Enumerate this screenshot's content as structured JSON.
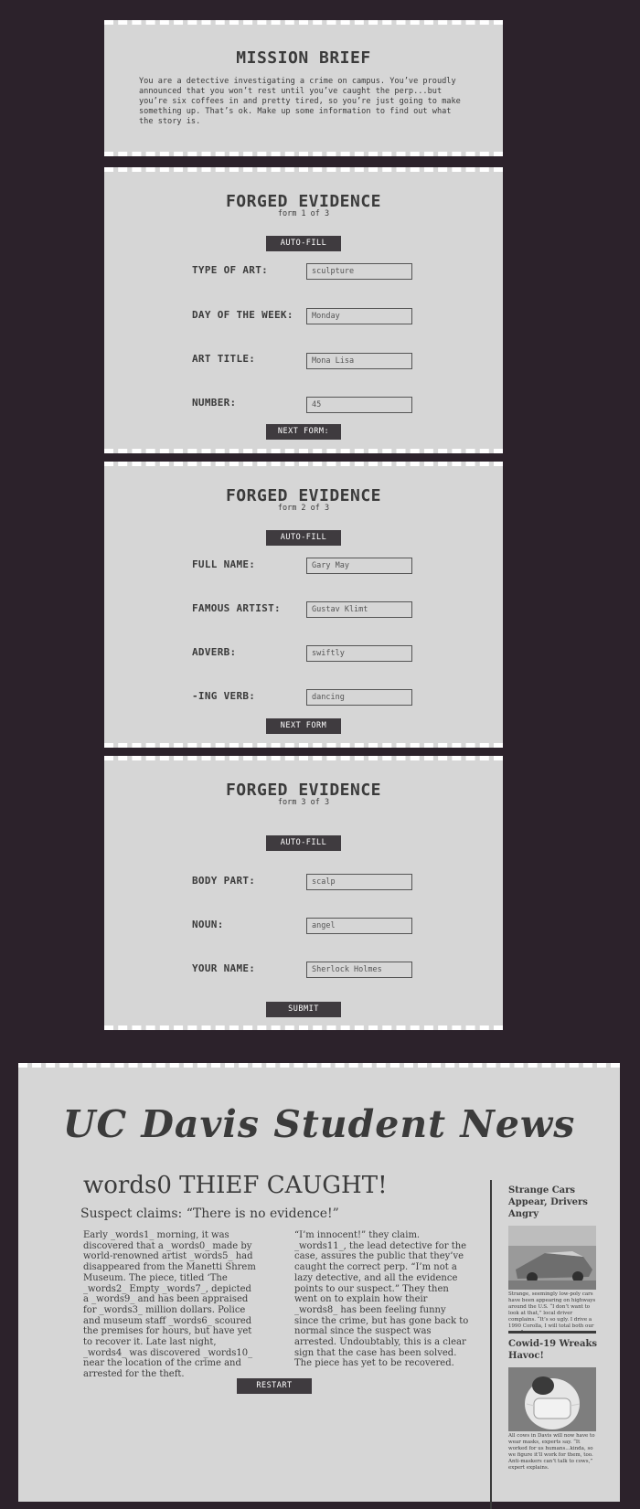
{
  "brief": {
    "title": "MISSION BRIEF",
    "text": "You are a detective investigating a crime on campus. You’ve proudly announced that you won’t rest until you’ve caught the perp...but you’re six coffees in and pretty tired, so you’re just going to make something up. That’s ok. Make up some information to find out what the story is."
  },
  "form1": {
    "title": "FORGED EVIDENCE",
    "subtitle": "form 1 of 3",
    "autofill": "AUTO-FILL",
    "next": "NEXT FORM:",
    "rows": [
      {
        "label": "TYPE OF ART:",
        "value": "sculpture"
      },
      {
        "label": "DAY OF THE WEEK:",
        "value": "Monday"
      },
      {
        "label": "ART TITLE:",
        "value": "Mona Lisa"
      },
      {
        "label": "NUMBER:",
        "value": "45"
      }
    ]
  },
  "form2": {
    "title": "FORGED EVIDENCE",
    "subtitle": "form 2 of 3",
    "autofill": "AUTO-FILL",
    "next": "NEXT FORM",
    "rows": [
      {
        "label": "FULL NAME:",
        "value": "Gary May"
      },
      {
        "label": "FAMOUS ARTIST:",
        "value": "Gustav Klimt"
      },
      {
        "label": "ADVERB:",
        "value": "swiftly"
      },
      {
        "label": "-ING VERB:",
        "value": "dancing"
      }
    ]
  },
  "form3": {
    "title": "FORGED EVIDENCE",
    "subtitle": "form 3 of 3",
    "autofill": "AUTO-FILL",
    "submit": "SUBMIT",
    "rows": [
      {
        "label": "BODY PART:",
        "value": "scalp"
      },
      {
        "label": "NOUN:",
        "value": "angel"
      },
      {
        "label": "YOUR NAME:",
        "value": "Sherlock Holmes"
      }
    ]
  },
  "news": {
    "masthead": "UC Davis Student News",
    "headline": "words0 THIEF CAUGHT!",
    "subhead": "Suspect claims: “There is no evidence!”",
    "col1": "Early _words1_ morning, it was discovered that a _words0_ made by world-renowned artist _words5_ had disappeared from the Manetti Shrem Museum. The piece, titled ‘The _words2_ Empty _words7_, depicted a _words9_ and has been appraised for _words3_ million dollars. Police and museum staff _words6_ scoured the premises for hours, but have yet to recover it. Late last night, _words4_ was discovered _words10_ near the location of the crime and arrested for the theft.",
    "col2": "“I’m innocent!” they claim. _words11_, the lead detective for the case, assures the public that they’ve caught the correct perp. “I’m not a lazy detective, and all the evidence points to our suspect.” They then went on to explain how their _words8_ has been feeling funny since the crime, but has gone back to normal since the suspect was arrested. Undoubtably, this is a clear sign that the case has been solved. The piece has yet to be recovered.",
    "side1_title": "Strange Cars Appear, Drivers Angry",
    "side1_caption": "Strange, seemingly low-poly cars have been appearing on highways around the U.S. “I don’t want to look at that,” local driver complains. “It’s so ugly. I drive a 1990 Corolla, I will total both our cars.”",
    "side2_title": "Cowid-19 Wreaks Havoc!",
    "side2_caption": "All cows in Davis will now have to wear masks, experts say. “It worked for us humans...kinda, so we figure it’ll work for them, too. Anti-maskers can’t talk to cows,” expert explains.",
    "restart": "RESTART"
  }
}
